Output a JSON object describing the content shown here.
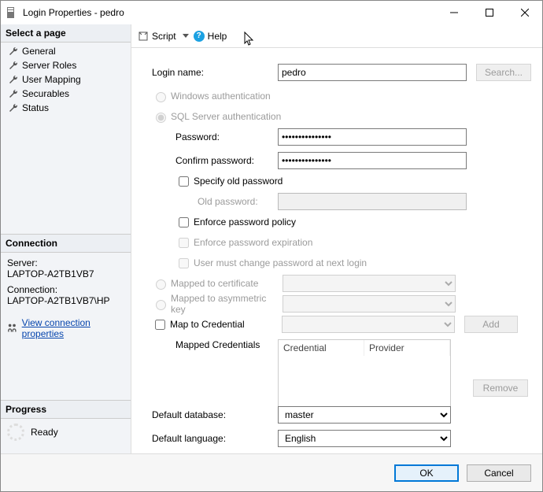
{
  "window": {
    "title": "Login Properties - pedro"
  },
  "left": {
    "selectPageHeader": "Select a page",
    "pages": [
      "General",
      "Server Roles",
      "User Mapping",
      "Securables",
      "Status"
    ],
    "connectionHeader": "Connection",
    "serverLabel": "Server:",
    "serverValue": "LAPTOP-A2TB1VB7",
    "connectionLabel": "Connection:",
    "connectionValue": "LAPTOP-A2TB1VB7\\HP",
    "viewConnProps": "View connection properties",
    "progressHeader": "Progress",
    "progressStatus": "Ready"
  },
  "toolbar": {
    "script": "Script",
    "help": "Help"
  },
  "form": {
    "loginNameLabel": "Login name:",
    "loginName": "pedro",
    "searchBtn": "Search...",
    "winAuth": "Windows authentication",
    "sqlAuth": "SQL Server authentication",
    "passwordLabel": "Password:",
    "password": "•••••••••••••••",
    "confirmLabel": "Confirm password:",
    "confirm": "•••••••••••••••",
    "specifyOld": "Specify old password",
    "oldPasswordLabel": "Old password:",
    "enforcePolicy": "Enforce password policy",
    "enforceExpire": "Enforce password expiration",
    "mustChange": "User must change password at next login",
    "mappedCert": "Mapped to certificate",
    "mappedAsym": "Mapped to asymmetric key",
    "mapCred": "Map to Credential",
    "addBtn": "Add",
    "mappedCredsLabel": "Mapped Credentials",
    "colCredential": "Credential",
    "colProvider": "Provider",
    "removeBtn": "Remove",
    "defaultDbLabel": "Default database:",
    "defaultDb": "master",
    "defaultLangLabel": "Default language:",
    "defaultLang": "English"
  },
  "footer": {
    "ok": "OK",
    "cancel": "Cancel"
  }
}
